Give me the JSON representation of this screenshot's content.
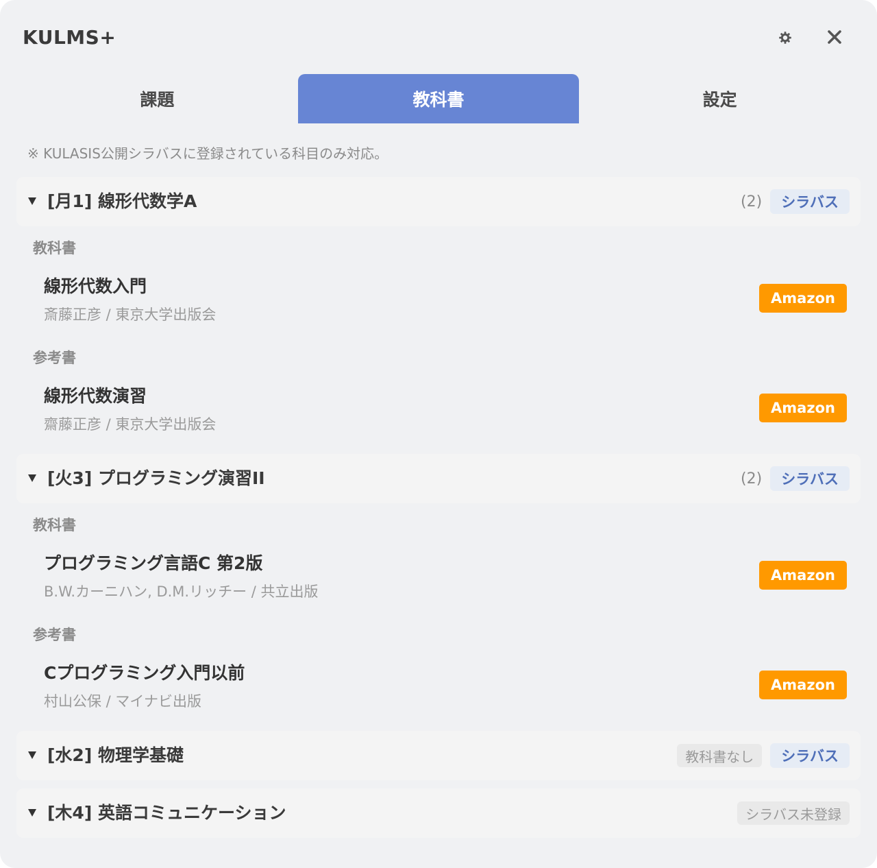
{
  "app": {
    "title": "KULMS+"
  },
  "header": {
    "settings_icon": "gear-icon",
    "close_icon": "close-icon"
  },
  "tabs": [
    {
      "label": "課題",
      "active": false
    },
    {
      "label": "教科書",
      "active": true
    },
    {
      "label": "設定",
      "active": false
    }
  ],
  "notice": "※ KULASIS公開シラバスに登録されている科目のみ対応。",
  "colors": {
    "accent": "#6785d4",
    "amazon": "#ff9900",
    "syllabus_text": "#4f6fb8"
  },
  "courses": [
    {
      "title": "[月1] 線形代数学A",
      "count": "(2)",
      "syllabus_label": "シラバス",
      "sections": [
        {
          "label": "教科書",
          "book": {
            "title": "線形代数入門",
            "meta": "斎藤正彦 / 東京大学出版会",
            "button": "Amazon"
          }
        },
        {
          "label": "参考書",
          "book": {
            "title": "線形代数演習",
            "meta": "齋藤正彦 / 東京大学出版会",
            "button": "Amazon"
          }
        }
      ]
    },
    {
      "title": "[火3] プログラミング演習II",
      "count": "(2)",
      "syllabus_label": "シラバス",
      "sections": [
        {
          "label": "教科書",
          "book": {
            "title": "プログラミング言語C 第2版",
            "meta": "B.W.カーニハン, D.M.リッチー / 共立出版",
            "button": "Amazon"
          }
        },
        {
          "label": "参考書",
          "book": {
            "title": "Cプログラミング入門以前",
            "meta": "村山公保 / マイナビ出版",
            "button": "Amazon"
          }
        }
      ]
    },
    {
      "title": "[水2] 物理学基礎",
      "status_badge": "教科書なし",
      "syllabus_label": "シラバス"
    },
    {
      "title": "[木4] 英語コミュニケーション",
      "status_badge": "シラバス未登録"
    }
  ]
}
